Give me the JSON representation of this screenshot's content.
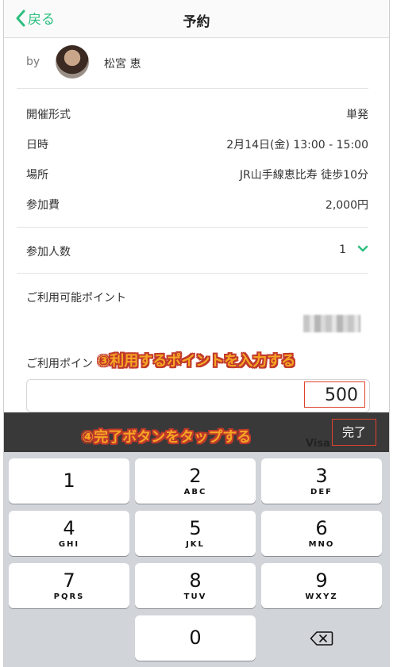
{
  "nav": {
    "back_label": "戻る",
    "title": "予約"
  },
  "host": {
    "by_label": "by",
    "name": "松宮 恵"
  },
  "details": [
    {
      "label": "開催形式",
      "value": "単発"
    },
    {
      "label": "日時",
      "value": "2月14日(金) 13:00 - 15:00"
    },
    {
      "label": "場所",
      "value": "JR山手線恵比寿 徒歩10分"
    },
    {
      "label": "参加費",
      "value": "2,000円"
    }
  ],
  "participants": {
    "label": "参加人数",
    "value": "1"
  },
  "points": {
    "label": "ご利用可能ポイント",
    "use_label": "ご利用ポイン",
    "input_value": "500"
  },
  "annotations": {
    "step3": "③利用するポイントを入力する",
    "step4": "④完了ボタンをタップする"
  },
  "peek_text": "Visa",
  "toolbar": {
    "done_label": "完了"
  },
  "keypad": {
    "keys": [
      {
        "digit": "1",
        "letters": ""
      },
      {
        "digit": "2",
        "letters": "ABC"
      },
      {
        "digit": "3",
        "letters": "DEF"
      },
      {
        "digit": "4",
        "letters": "GHI"
      },
      {
        "digit": "5",
        "letters": "JKL"
      },
      {
        "digit": "6",
        "letters": "MNO"
      },
      {
        "digit": "7",
        "letters": "PQRS"
      },
      {
        "digit": "8",
        "letters": "TUV"
      },
      {
        "digit": "9",
        "letters": "WXYZ"
      },
      {
        "digit": "0",
        "letters": ""
      }
    ]
  },
  "colors": {
    "accent": "#2cbf7f",
    "highlight": "#e0422c",
    "annotation_fill": "#f6a623"
  }
}
